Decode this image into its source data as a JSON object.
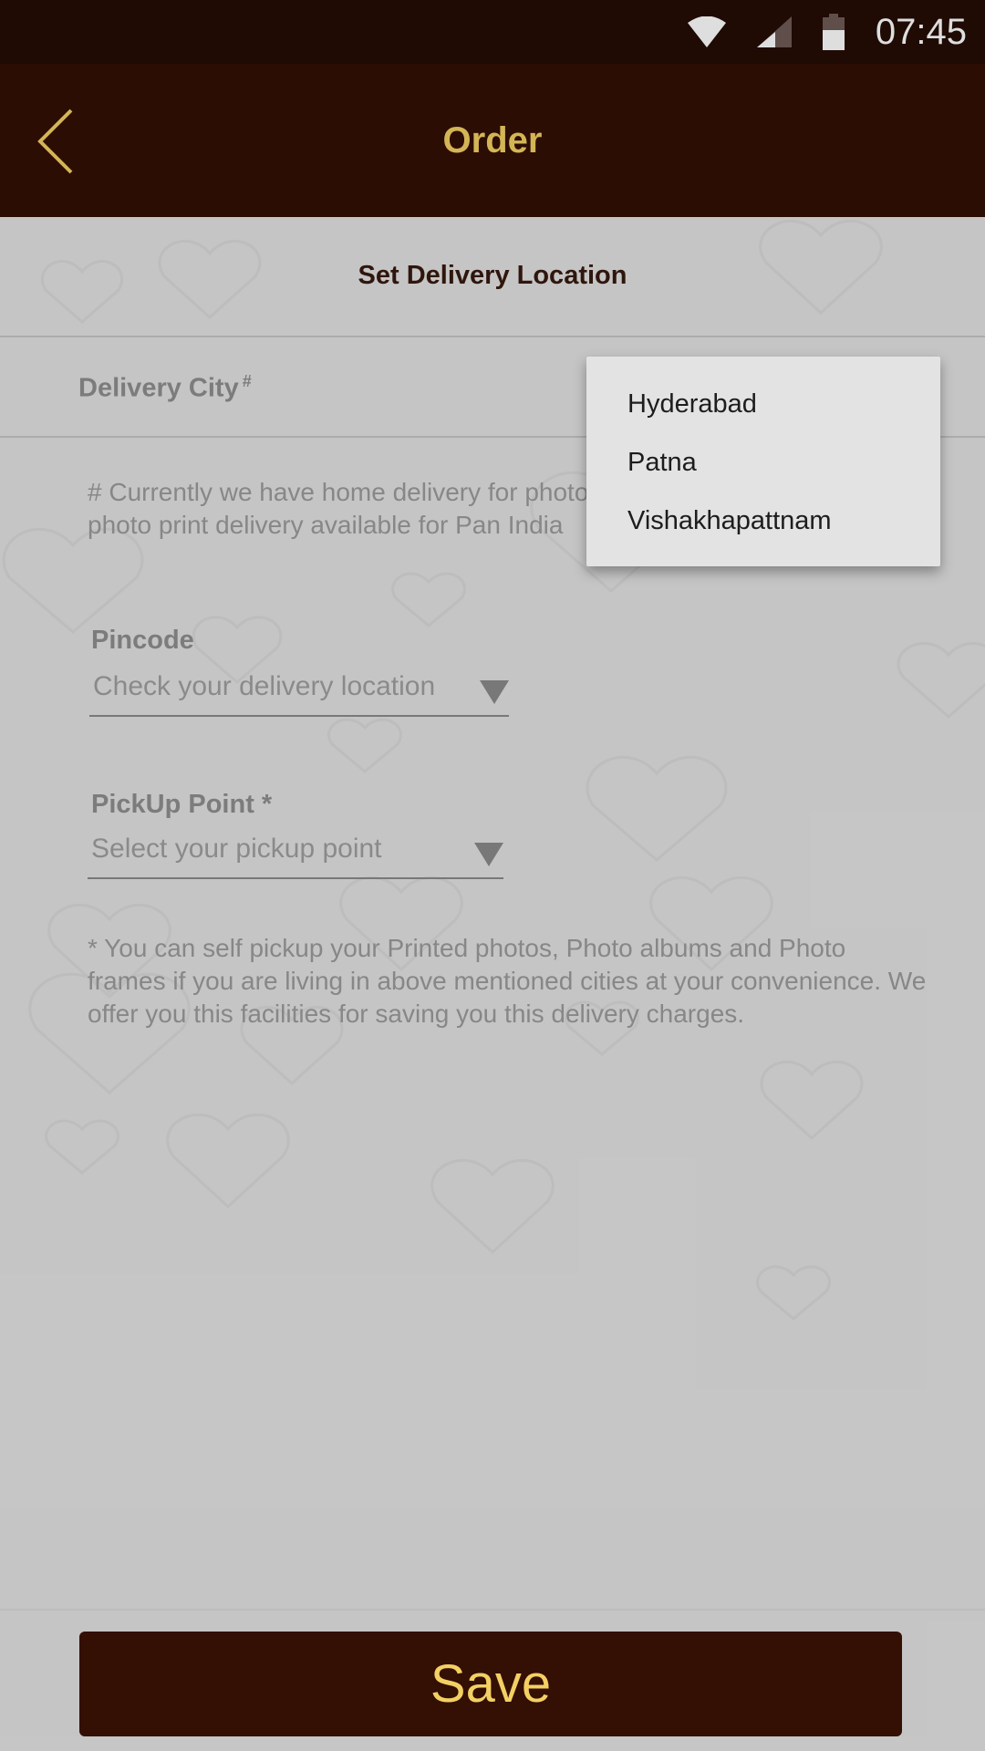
{
  "status_bar": {
    "time": "07:45",
    "icons": [
      "wifi-icon",
      "cell-signal-icon",
      "battery-icon"
    ]
  },
  "app_bar": {
    "title": "Order",
    "back_icon": "chevron-left-icon"
  },
  "section": {
    "title": "Set Delivery Location"
  },
  "delivery_city": {
    "label": "Delivery City",
    "marker": "#"
  },
  "home_delivery_note": "# Currently we have home delivery for photo albums in above location, photo print delivery available for Pan India",
  "pincode": {
    "label": "Pincode",
    "placeholder": "Check your delivery location"
  },
  "pickup_point": {
    "label": "PickUp Point *",
    "placeholder": "Select your pickup point"
  },
  "pickup_note": "* You can self pickup your Printed photos, Photo albums and Photo frames if you are living in above mentioned cities at your convenience. We offer you this facilities for saving you this delivery charges.",
  "city_dropdown": {
    "options": [
      "Hyderabad",
      "Patna",
      "Vishakhapattnam"
    ]
  },
  "save_button": {
    "label": "Save"
  },
  "colors": {
    "status_bar": "#240c05",
    "app_bar": "#330f04",
    "accent_gold": "#f3d063",
    "background": "#e3e3e3"
  }
}
